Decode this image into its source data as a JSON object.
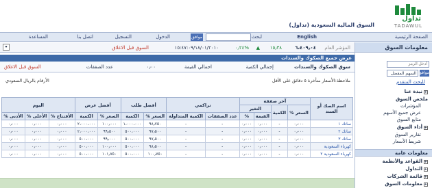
{
  "header": {
    "logo_arabic": "تداول",
    "logo_latin": "TADAWUL",
    "site_title": "السوق المالية السعودية (تداول)"
  },
  "topnav": {
    "home": "الصفحة الرئيسية",
    "english": "English",
    "search_label": "ابحث",
    "search_placeholder": "",
    "search_go": "موافق",
    "login": "الدخول",
    "register": "التسجيل",
    "contact": "اتصل بنا",
    "help": "المساعدة"
  },
  "ticker": {
    "label": "معلومات السوق",
    "index_label": "المؤشر العام",
    "index_value": "٦،٤٠٩٫٠٤",
    "change": "١٥٫٣٨",
    "change_pct": "%٠٫٢٤",
    "datetime": "١٥:٤٧:٠٩/١٨/٠١/٢٠١٠",
    "status": "السوق قبل الاغلاق"
  },
  "sidebar": {
    "header": "معلومات السوق",
    "symbol_placeholder": "أدخل الرمز",
    "select_value": "السهم المفضل",
    "go_label": "موافق",
    "advanced_link": "للبحث المتقدم",
    "tree": [
      {
        "label": "نبذة عنا",
        "type": "item"
      },
      {
        "label": "ملخص السوق",
        "type": "item"
      },
      {
        "label": "المؤشرات",
        "type": "sub"
      },
      {
        "label": "عرض جميع الأسهم",
        "type": "sub"
      },
      {
        "label": "متابع السوق",
        "type": "sub"
      },
      {
        "label": "أداء السوق",
        "type": "item"
      },
      {
        "label": "تقارير السوق",
        "type": "sub"
      },
      {
        "label": "شريط الأسعار",
        "type": "sub"
      }
    ],
    "section2": "معلومات عامة",
    "tree2": [
      {
        "label": "القواعد والأنظمة"
      },
      {
        "label": "التداول"
      },
      {
        "label": "قائمة الشركات"
      },
      {
        "label": "معلومات السوق"
      }
    ]
  },
  "content": {
    "title": "عرض جميع الصكوك والسندات",
    "summary": {
      "category": "سوق الصكوك والسندات",
      "qty_label": "إجمالي الكمية",
      "value_label": "اجمالي القيمة",
      "value": "٠٫٠٠",
      "deals_label": "عدد الصفقات",
      "status": "السوق قبل الاغلاق"
    },
    "note_delay": "ملاحظة:الأسعار متأخرة ٥ دقائق على الأقل",
    "note_currency": "الأرقام بالريال السعودي"
  },
  "table": {
    "group_headers": {
      "name": "اسم الصك أو السند",
      "last_deal": "آخر صفقة",
      "change": "التغير",
      "cumulative": "تراكمي",
      "best_bid": "أفضل طلب",
      "best_ask": "أفضل عرض",
      "today": "اليوم"
    },
    "sub_headers": {
      "price": "السعر %",
      "qty": "الكمية",
      "value": "القيمة",
      "pct": "%",
      "deals": "عدد الصفقات",
      "traded_qty": "الكمية المتداولة",
      "bid_price": "السعر %",
      "bid_qty": "الكمية",
      "ask_price": "السعر %",
      "ask_qty": "الكمية",
      "open": "الأفتتاح %",
      "high": "الأعلى %",
      "low": "الأدنى %"
    },
    "rows": [
      {
        "name": "ساتك ١",
        "price": "٠٫٠٠٠",
        "qty": "-",
        "value": "٠٫٠٠٠",
        "pct": "٠٫٠٠٠",
        "deals": "-",
        "traded": "-",
        "bid_price": "٩٨٫٧٥٠",
        "bid_qty": "١،٠٠٠،٠٠٠",
        "ask_price": "١٠٠٫٠٠٠",
        "ask_qty": "٢،٠٠٠،٠٠٠",
        "open": "٠٫٠٠٠",
        "high": "٠٫٠٠٠",
        "low": "٠٫٠٠٠"
      },
      {
        "name": "ساتك ٢",
        "price": "٠٫٠٠٠",
        "qty": "-",
        "value": "٠٫٠٠٠",
        "pct": "٠٫٠٠٠",
        "deals": "-",
        "traded": "-",
        "bid_price": "٩٧٫٥٠٠",
        "bid_qty": "٥٠٠،٠٠٠",
        "ask_price": "٩٩٫٥٠٠",
        "ask_qty": "٢،٠٠٠،٠٠٠",
        "open": "٠٫٠٠٠",
        "high": "٠٫٠٠٠",
        "low": "٠٫٠٠٠"
      },
      {
        "name": "ساتك ٣",
        "price": "٠٫٠٠٠",
        "qty": "-",
        "value": "٠٫٠٠٠",
        "pct": "٠٫٠٠٠",
        "deals": "-",
        "traded": "-",
        "bid_price": "٩٧٫٥٠٠",
        "bid_qty": "٥٠٠،٠٠٠",
        "ask_price": "٩٩٫٠٠٠",
        "ask_qty": "٥٠٠،٠٠٠",
        "open": "٠٫٠٠٠",
        "high": "٠٫٠٠٠",
        "low": "٠٫٠٠٠"
      },
      {
        "name": "كهرباء السعودية",
        "price": "٠٫٠٠٠",
        "qty": "-",
        "value": "٠٫٠٠٠",
        "pct": "٠٫٠٠٠",
        "deals": "-",
        "traded": "-",
        "bid_price": "٩٨٫٥٠٠",
        "bid_qty": "٥٠٠،٠٠٠",
        "ask_price": "١٠٠٫٠٠٠",
        "ask_qty": "٥٠٠،٠٠٠",
        "open": "٠٫٠٠٠",
        "high": "٠٫٠٠٠",
        "low": "٠٫٠٠٠"
      },
      {
        "name": "كهرباء السعودية ٢",
        "price": "٠٫٠٠٠",
        "qty": "-",
        "value": "٠٫٠٠٠",
        "pct": "٠٫٠٠٠",
        "deals": "-",
        "traded": "-",
        "bid_price": "١٠٠٫٧٥٠",
        "bid_qty": "٥٠٠،٠٠٠",
        "ask_price": "١٠١٫٧٥٠",
        "ask_qty": "٥٠٠،٠٠٠",
        "open": "٠٫٠٠٠",
        "high": "٠٫٠٠٠",
        "low": "٠٫٠٠٠"
      }
    ]
  },
  "colors": {
    "brand_green": "#1e8a3c",
    "nav_blue": "#3e6aa8",
    "up_green": "#1e8a3c",
    "status_red": "#c0392b"
  }
}
